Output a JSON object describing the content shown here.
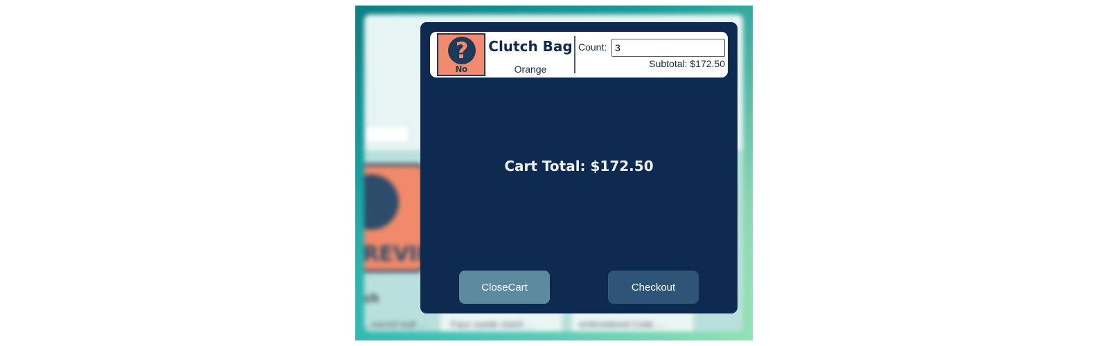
{
  "background_page": {
    "product_tile_text": "PREVIEW",
    "product_name_partial": "ch",
    "card_texts": [
      "...earred wall ...",
      "Faux suede clutch ...",
      "embroidered Code ..."
    ]
  },
  "cart": {
    "items": [
      {
        "thumbnail": {
          "icon": "question-mark-icon",
          "placeholder_text": "No Preview"
        },
        "name": "Clutch Bag",
        "color": "Orange",
        "count_label": "Count:",
        "count_value": "3",
        "subtotal_text": "Subtotal: $172.50"
      }
    ],
    "total_text": "Cart Total: $172.50",
    "buttons": {
      "close_label": "CloseCart",
      "checkout_label": "Checkout"
    }
  },
  "colors": {
    "modal_background": "#0e2a50",
    "close_button": "#5c8a9e",
    "checkout_button": "#2e5578",
    "placeholder_orange": "#f28a6e"
  }
}
